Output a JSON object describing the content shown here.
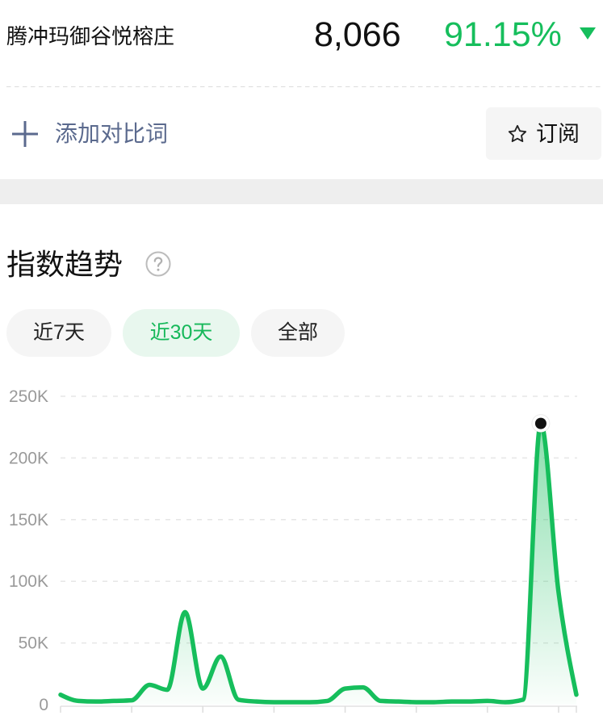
{
  "header": {
    "title": "腾冲玛御谷悦榕庄",
    "value": "8,066",
    "change": "91.15%",
    "change_icon": "triangle-down-icon"
  },
  "actions": {
    "add_compare_label": "添加对比词",
    "add_compare_icon": "plus-icon",
    "subscribe_label": "订阅",
    "subscribe_icon": "star-outline-icon"
  },
  "trend": {
    "heading": "指数趋势",
    "help_icon": "question-circle-icon",
    "tabs": [
      {
        "label": "近7天",
        "active": false
      },
      {
        "label": "近30天",
        "active": true
      },
      {
        "label": "全部",
        "active": false
      }
    ]
  },
  "colors": {
    "accent": "#16be5c",
    "accent_text": "#16b85a",
    "accent_bg": "#e8f7ee",
    "secondary_text": "#5b6a8e",
    "axis_text": "#9a9a9a",
    "peak_marker": "#111111"
  },
  "chart_data": {
    "type": "area",
    "values": [
      8000,
      3000,
      2500,
      3000,
      3500,
      16000,
      12000,
      75000,
      13000,
      39000,
      4000,
      2500,
      2000,
      2000,
      2000,
      3000,
      13000,
      14000,
      3000,
      2500,
      2000,
      2000,
      2500,
      2500,
      3000,
      2000,
      4000,
      228000,
      91000,
      8066
    ],
    "yticks": [
      0,
      50000,
      100000,
      150000,
      200000,
      250000
    ],
    "ytick_labels": [
      "0",
      "50K",
      "100K",
      "150K",
      "200K",
      "250K"
    ],
    "ylim": [
      0,
      250000
    ],
    "grid": true,
    "legend": "none"
  }
}
